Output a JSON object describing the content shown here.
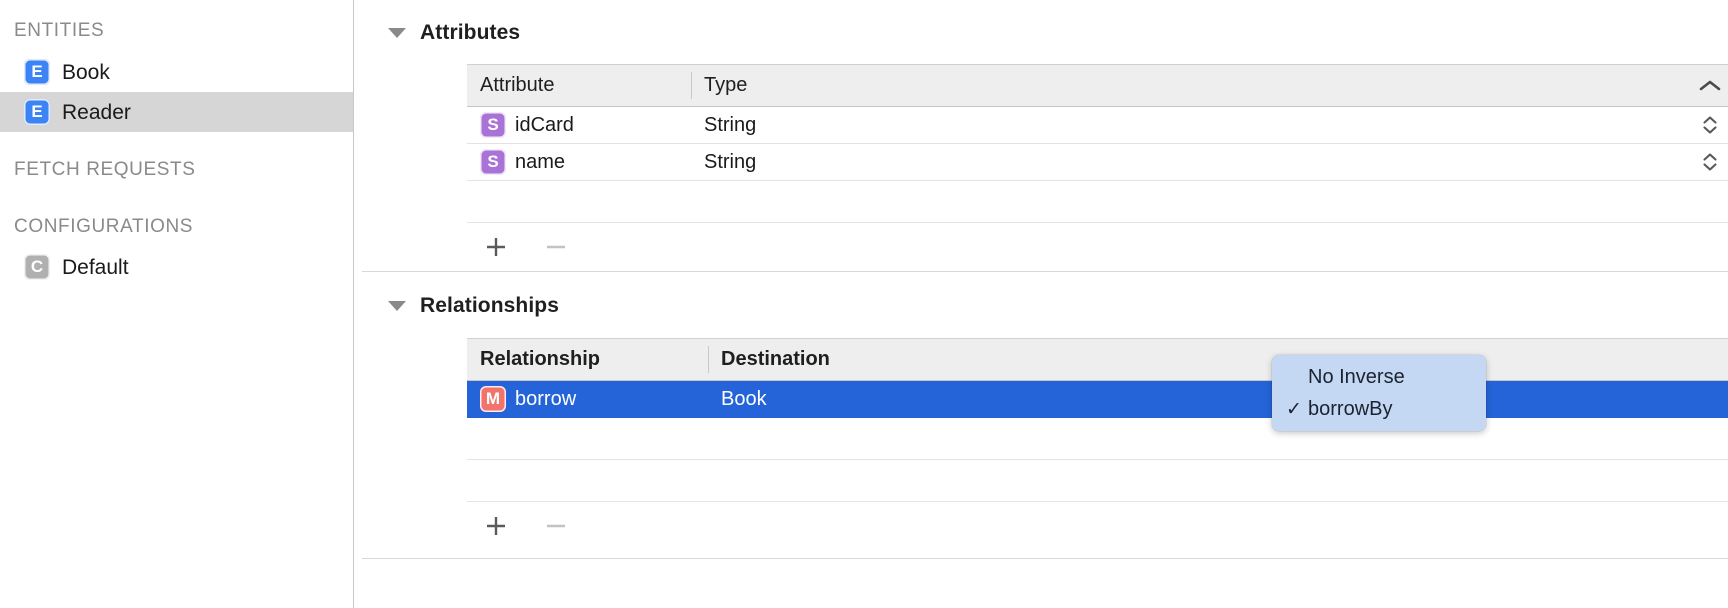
{
  "sidebar": {
    "sections": [
      {
        "header": "ENTITIES",
        "items": [
          {
            "label": "Book",
            "badge": "E",
            "badge_kind": "entity",
            "selected": false
          },
          {
            "label": "Reader",
            "badge": "E",
            "badge_kind": "entity",
            "selected": true
          }
        ]
      },
      {
        "header": "FETCH REQUESTS",
        "items": []
      },
      {
        "header": "CONFIGURATIONS",
        "items": [
          {
            "label": "Default",
            "badge": "C",
            "badge_kind": "config",
            "selected": false
          }
        ]
      }
    ]
  },
  "attributes_section": {
    "title": "Attributes",
    "disclosure_icon": "triangle-down-icon",
    "columns": [
      {
        "label": "Attribute"
      },
      {
        "label": "Type"
      }
    ],
    "sort_indicator_icon": "chevron-up-icon",
    "sort_column": "Type",
    "sort_direction": "ascending",
    "rows": [
      {
        "badge": "S",
        "name": "idCard",
        "type": "String",
        "stepper_icon": "chevron-up-down-icon"
      },
      {
        "badge": "S",
        "name": "name",
        "type": "String",
        "stepper_icon": "chevron-up-down-icon"
      }
    ],
    "footer": {
      "add_label": "+",
      "add_icon": "plus-icon",
      "remove_label": "—",
      "remove_icon": "minus-icon",
      "remove_disabled": true
    }
  },
  "relationships_section": {
    "title": "Relationships",
    "disclosure_icon": "triangle-down-icon",
    "columns": [
      {
        "label": "Relationship"
      },
      {
        "label": "Destination"
      }
    ],
    "rows": [
      {
        "badge": "M",
        "name": "borrow",
        "destination": "Book",
        "selected": true
      }
    ],
    "footer": {
      "add_label": "+",
      "add_icon": "plus-icon",
      "remove_label": "—",
      "remove_icon": "minus-icon",
      "remove_disabled": true
    }
  },
  "inverse_popup": {
    "items": [
      {
        "label": "No Inverse",
        "checked": false,
        "check_glyph": ""
      },
      {
        "label": "borrowBy",
        "checked": true,
        "check_glyph": "✓"
      }
    ]
  },
  "colors": {
    "selection_blue": "#2464d8",
    "sidebar_selection": "#d6d6d6",
    "entity_badge": "#3c83f6",
    "attribute_badge": "#a972d6",
    "relationship_badge": "#f2736b",
    "config_badge": "#b0b0b0",
    "popup_background": "#c5d8f3",
    "header_background": "#eeeeee"
  }
}
